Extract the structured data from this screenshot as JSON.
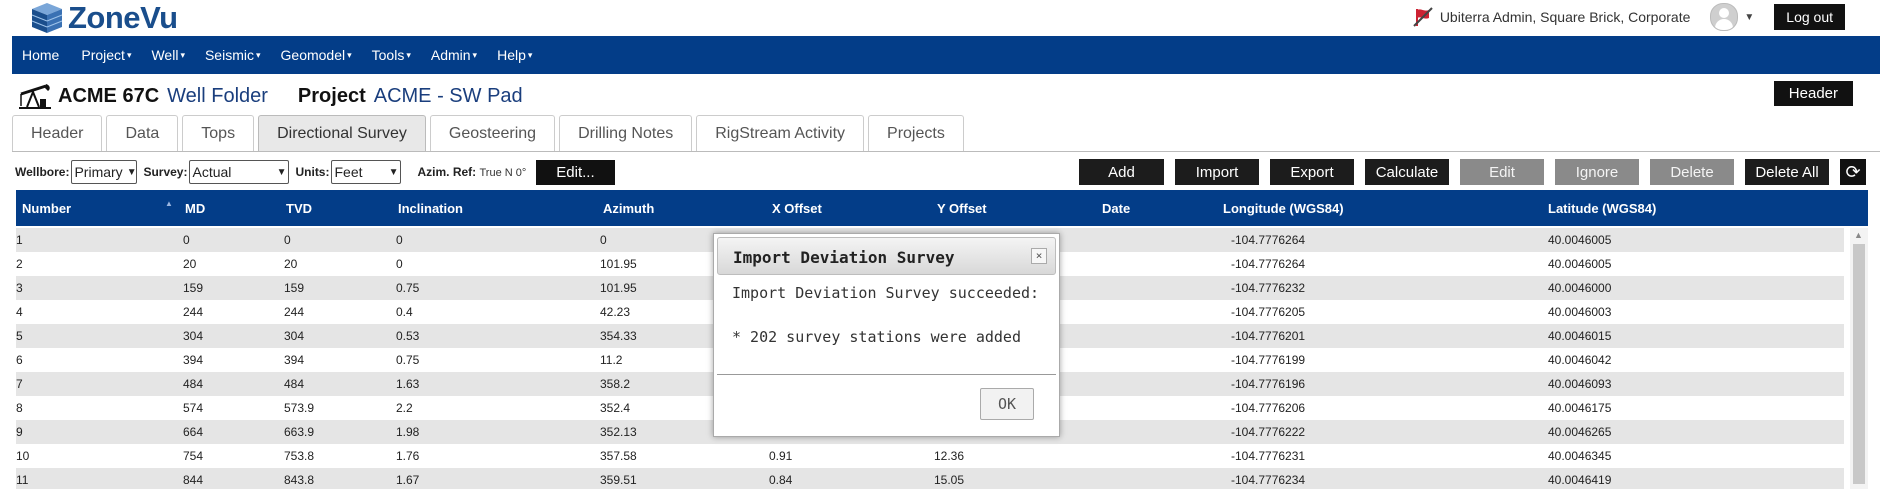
{
  "app": {
    "logo_text_a": "Zone",
    "logo_text_b": "Vu",
    "user_label": "Ubiterra Admin, Square Brick, Corporate",
    "logout_label": "Log out"
  },
  "nav": [
    {
      "label": "Home",
      "caret": ""
    },
    {
      "label": "Project",
      "caret": "▾"
    },
    {
      "label": "Well",
      "caret": "▾"
    },
    {
      "label": "Seismic",
      "caret": "▾"
    },
    {
      "label": "Geomodel",
      "caret": "▾"
    },
    {
      "label": "Tools",
      "caret": "▾"
    },
    {
      "label": "Admin",
      "caret": "▾"
    },
    {
      "label": "Help",
      "caret": "▾"
    }
  ],
  "title": {
    "well_name": "ACME 67C",
    "well_sub": "Well Folder",
    "project_label": "Project",
    "project_name": "ACME - SW Pad",
    "header_button": "Header"
  },
  "tabs": [
    {
      "label": "Header",
      "active": false
    },
    {
      "label": "Data",
      "active": false
    },
    {
      "label": "Tops",
      "active": false
    },
    {
      "label": "Directional Survey",
      "active": true
    },
    {
      "label": "Geosteering",
      "active": false
    },
    {
      "label": "Drilling Notes",
      "active": false
    },
    {
      "label": "RigStream Activity",
      "active": false
    },
    {
      "label": "Projects",
      "active": false
    }
  ],
  "controls": {
    "wellbore_label": "Wellbore:",
    "wellbore_value": "Primary",
    "survey_label": "Survey:",
    "survey_value": "Actual",
    "units_label": "Units:",
    "units_value": "Feet",
    "azim_label": "Azim. Ref:",
    "azim_value": "True N 0°",
    "edit_button": "Edit..."
  },
  "actions": [
    {
      "label": "Add",
      "style": "dark"
    },
    {
      "label": "Import",
      "style": "dark"
    },
    {
      "label": "Export",
      "style": "dark"
    },
    {
      "label": "Calculate",
      "style": "dark"
    },
    {
      "label": "Edit",
      "style": "gray"
    },
    {
      "label": "Ignore",
      "style": "gray"
    },
    {
      "label": "Delete",
      "style": "gray"
    },
    {
      "label": "Delete All",
      "style": "dark"
    }
  ],
  "table": {
    "columns": [
      "Number",
      "MD",
      "TVD",
      "Inclination",
      "Azimuth",
      "X Offset",
      "Y Offset",
      "Date",
      "Longitude (WGS84)",
      "Latitude (WGS84)"
    ],
    "rows": [
      [
        "1",
        "0",
        "0",
        "0",
        "0",
        "",
        "",
        "",
        "-104.7776264",
        "40.0046005"
      ],
      [
        "2",
        "20",
        "20",
        "0",
        "101.95",
        "",
        "",
        "",
        "-104.7776264",
        "40.0046005"
      ],
      [
        "3",
        "159",
        "159",
        "0.75",
        "101.95",
        "",
        "",
        "",
        "-104.7776232",
        "40.0046000"
      ],
      [
        "4",
        "244",
        "244",
        "0.4",
        "42.23",
        "",
        "",
        "",
        "-104.7776205",
        "40.0046003"
      ],
      [
        "5",
        "304",
        "304",
        "0.53",
        "354.33",
        "",
        "",
        "",
        "-104.7776201",
        "40.0046015"
      ],
      [
        "6",
        "394",
        "394",
        "0.75",
        "11.2",
        "",
        "",
        "",
        "-104.7776199",
        "40.0046042"
      ],
      [
        "7",
        "484",
        "484",
        "1.63",
        "358.2",
        "",
        "",
        "",
        "-104.7776196",
        "40.0046093"
      ],
      [
        "8",
        "574",
        "573.9",
        "2.2",
        "352.4",
        "",
        "",
        "",
        "-104.7776206",
        "40.0046175"
      ],
      [
        "9",
        "664",
        "663.9",
        "1.98",
        "352.13",
        "",
        "",
        "",
        "-104.7776222",
        "40.0046265"
      ],
      [
        "10",
        "754",
        "753.8",
        "1.76",
        "357.58",
        "0.91",
        "12.36",
        "",
        "-104.7776231",
        "40.0046345"
      ],
      [
        "11",
        "844",
        "843.8",
        "1.67",
        "359.51",
        "0.84",
        "15.05",
        "",
        "-104.7776234",
        "40.0046419"
      ]
    ]
  },
  "modal": {
    "title": "Import Deviation Survey",
    "close": "×",
    "message": "Import Deviation Survey succeeded:",
    "detail": "* 202 survey stations were added",
    "ok_label": "OK"
  },
  "colors": {
    "nav_bg": "#033d88",
    "header_bg": "#033d88",
    "row_alt": "#e5e5e5",
    "button_dark": "#1c1c1c",
    "button_gray": "#8a8a8a"
  }
}
